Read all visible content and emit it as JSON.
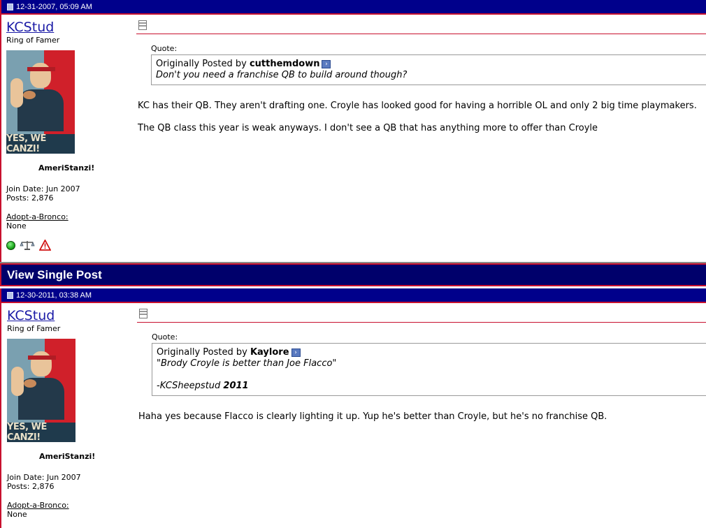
{
  "posts": [
    {
      "date": "12-31-2007, 05:09 AM",
      "username": "KCStud",
      "user_title": "Ring of Famer",
      "avatar_caption": "YES, WE CANZI!",
      "custom_name": "AmeriStanzi!",
      "join_date": "Join Date: Jun 2007",
      "posts": "Posts: 2,876",
      "adopt_label": "Adopt-a-Bronco:",
      "adopt_value": "None",
      "quote_label": "Quote:",
      "quote_prefix": "Originally Posted by ",
      "quote_author": "cutthemdown",
      "quote_lines": [
        "Don't you need a franchise QB to build around though?"
      ],
      "message": [
        "KC has their QB. They aren't drafting one. Croyle has looked good for having a horrible OL and only 2 big time playmakers.",
        "The QB class this year is weak anyways. I don't see a QB that has anything more to offer than Croyle"
      ]
    },
    {
      "date": "12-30-2011, 03:38 AM",
      "username": "KCStud",
      "user_title": "Ring of Famer",
      "avatar_caption": "YES, WE CANZI!",
      "custom_name": "AmeriStanzi!",
      "join_date": "Join Date: Jun 2007",
      "posts": "Posts: 2,876",
      "adopt_label": "Adopt-a-Bronco:",
      "adopt_value": "None",
      "quote_label": "Quote:",
      "quote_prefix": "Originally Posted by ",
      "quote_author": "Kaylore",
      "quote_line_1": "\"Brody Croyle is better than Joe Flacco\"",
      "quote_sig_prefix": "-KCSheepstud ",
      "quote_sig_year": "2011",
      "message": [
        "Haha yes because Flacco is clearly lighting it up. Yup he's better than Croyle, but he's no franchise QB."
      ]
    }
  ],
  "view_single_post": "View Single Post",
  "colors": {
    "header_bg": "#00008b",
    "accent": "#c8102e",
    "link": "#1a1aa6"
  },
  "icons": [
    "document-icon",
    "post-icon",
    "view-post-arrow-icon",
    "online-status-icon",
    "reputation-scales-icon",
    "report-post-icon"
  ]
}
